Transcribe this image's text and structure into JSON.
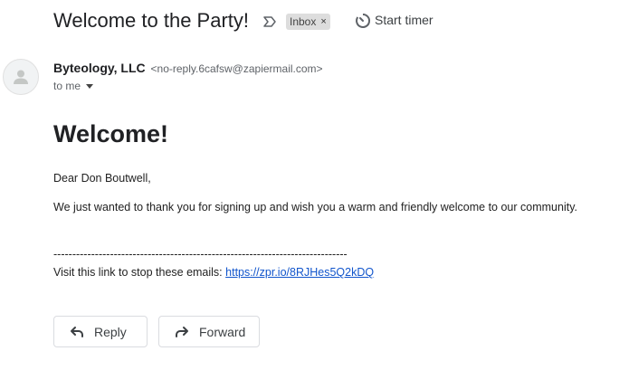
{
  "email": {
    "subject": "Welcome to the Party!",
    "label": "Inbox",
    "label_close": "×",
    "timer_label": "Start timer",
    "sender_name": "Byteology, LLC",
    "sender_email": "<no-reply.6cafsw@zapiermail.com>",
    "recipient": "to me"
  },
  "body": {
    "heading": "Welcome!",
    "greeting": "Dear Don Boutwell,",
    "message": "We just wanted to thank you for signing up and wish you a warm and friendly welcome to our community.",
    "separator": "------------------------------------------------------------------------------",
    "unsubscribe_text": "Visit this link to stop these emails: ",
    "unsubscribe_link": "https://zpr.io/8RJHes5Q2kDQ"
  },
  "actions": {
    "reply": "Reply",
    "forward": "Forward"
  },
  "icons": {
    "importance": "importance-marker-icon",
    "timer": "timer-icon",
    "avatar": "person-icon",
    "reply": "reply-arrow-icon",
    "forward": "forward-arrow-icon"
  }
}
